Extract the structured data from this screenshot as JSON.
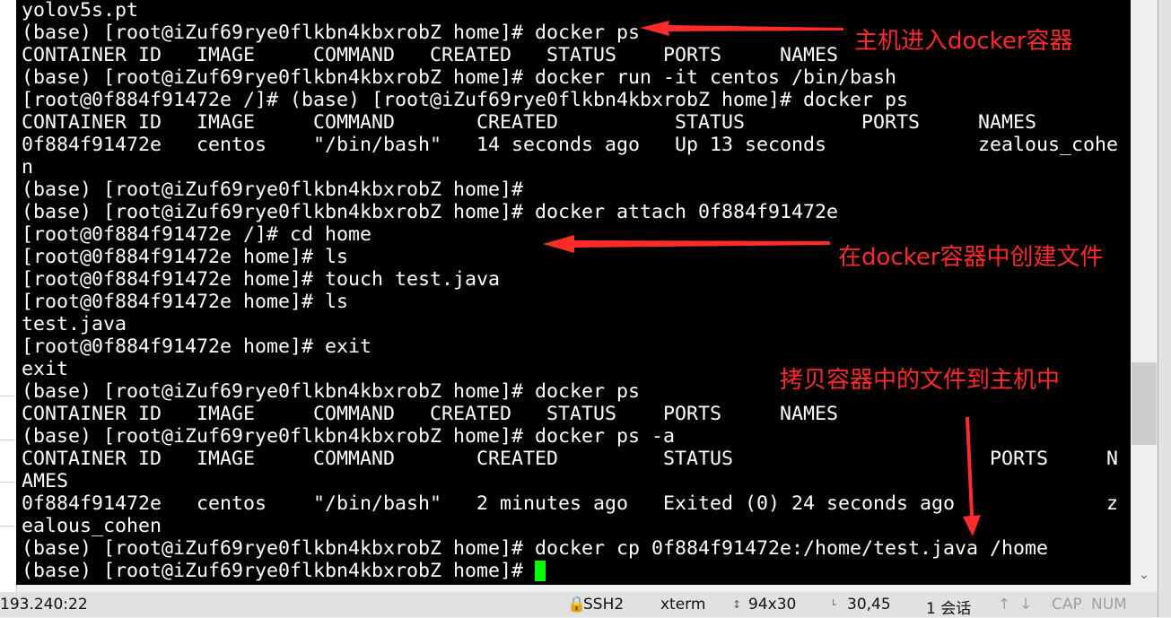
{
  "terminal": {
    "lines": [
      "yolov5s.pt",
      "(base) [root@iZuf69rye0flkbn4kbxrobZ home]# docker ps",
      "CONTAINER ID   IMAGE     COMMAND   CREATED   STATUS    PORTS     NAMES",
      "(base) [root@iZuf69rye0flkbn4kbxrobZ home]# docker run -it centos /bin/bash",
      "[root@0f884f91472e /]# (base) [root@iZuf69rye0flkbn4kbxrobZ home]# docker ps",
      "CONTAINER ID   IMAGE     COMMAND       CREATED          STATUS          PORTS     NAMES",
      "0f884f91472e   centos    \"/bin/bash\"   14 seconds ago   Up 13 seconds             zealous_cohe",
      "n",
      "(base) [root@iZuf69rye0flkbn4kbxrobZ home]#",
      "(base) [root@iZuf69rye0flkbn4kbxrobZ home]# docker attach 0f884f91472e",
      "[root@0f884f91472e /]# cd home",
      "[root@0f884f91472e home]# ls",
      "[root@0f884f91472e home]# touch test.java",
      "[root@0f884f91472e home]# ls",
      "test.java",
      "[root@0f884f91472e home]# exit",
      "exit",
      "(base) [root@iZuf69rye0flkbn4kbxrobZ home]# docker ps",
      "CONTAINER ID   IMAGE     COMMAND   CREATED   STATUS    PORTS     NAMES",
      "(base) [root@iZuf69rye0flkbn4kbxrobZ home]# docker ps -a",
      "CONTAINER ID   IMAGE     COMMAND       CREATED         STATUS                      PORTS     N",
      "AMES",
      "0f884f91472e   centos    \"/bin/bash\"   2 minutes ago   Exited (0) 24 seconds ago             z",
      "ealous_cohen",
      "(base) [root@iZuf69rye0flkbn4kbxrobZ home]# docker cp 0f884f91472e:/home/test.java /home",
      "(base) [root@iZuf69rye0flkbn4kbxrobZ home]# "
    ],
    "cursor_color": "#00ff00"
  },
  "annotations": {
    "enter_container": "主机进入docker容器",
    "create_file": "在docker容器中创建文件",
    "copy_file": "拷贝容器中的文件到主机中",
    "color": "#ff2a2a"
  },
  "status_bar": {
    "host": "193.240:22",
    "protocol": "SSH2",
    "term_type": "xterm",
    "size": "94x30",
    "cursor_pos": "30,45",
    "sessions": "1 会话",
    "caps": "CAP",
    "num": "NUM"
  }
}
